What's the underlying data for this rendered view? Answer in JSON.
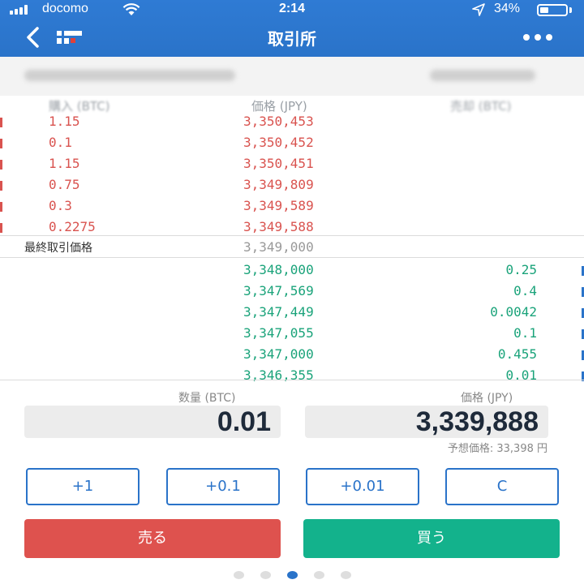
{
  "status_bar": {
    "carrier": "docomo",
    "time": "2:14",
    "battery": "34%",
    "battery_level": 0.34
  },
  "nav": {
    "title": "取引所"
  },
  "order_book": {
    "headers": {
      "buy": "購入 (BTC)",
      "price": "価格 (JPY)",
      "sell": "売却 (BTC)"
    },
    "asks": [
      {
        "qty": "1.15",
        "price": "3,350,453"
      },
      {
        "qty": "0.1",
        "price": "3,350,452"
      },
      {
        "qty": "1.15",
        "price": "3,350,451"
      },
      {
        "qty": "0.75",
        "price": "3,349,809"
      },
      {
        "qty": "0.3",
        "price": "3,349,589"
      },
      {
        "qty": "0.2275",
        "price": "3,349,588"
      }
    ],
    "last_trade": {
      "label": "最終取引価格",
      "price": "3,349,000"
    },
    "bids": [
      {
        "price": "3,348,000",
        "qty": "0.25"
      },
      {
        "price": "3,347,569",
        "qty": "0.4"
      },
      {
        "price": "3,347,449",
        "qty": "0.0042"
      },
      {
        "price": "3,347,055",
        "qty": "0.1"
      },
      {
        "price": "3,347,000",
        "qty": "0.455"
      },
      {
        "price": "3,346,355",
        "qty": "0.01"
      }
    ]
  },
  "order_form": {
    "amount_label": "数量 (BTC)",
    "amount_value": "0.01",
    "price_label": "価格 (JPY)",
    "price_value": "3,339,888",
    "expected": "予想価格: 33,398 円"
  },
  "quick_buttons": [
    "+1",
    "+0.1",
    "+0.01",
    "C"
  ],
  "actions": {
    "sell": "売る",
    "buy": "買う"
  },
  "pager": {
    "count": 5,
    "active": 3
  },
  "colors": {
    "brand": "#2a73c9",
    "ask": "#d9534f",
    "bid": "#1aa37a",
    "sell_button": "#de524e",
    "buy_button": "#13b28c"
  },
  "icons": [
    "wifi-icon",
    "location-icon",
    "battery-icon",
    "back-icon",
    "app-logo-icon",
    "more-icon"
  ]
}
